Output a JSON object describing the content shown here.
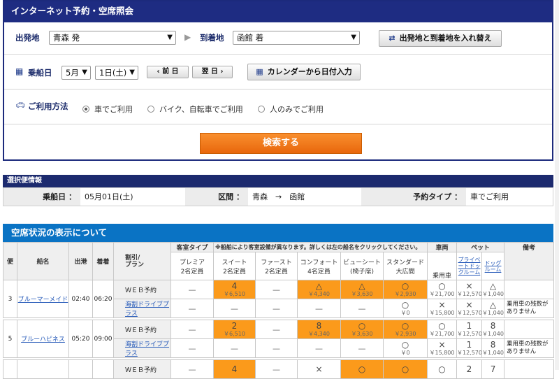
{
  "search": {
    "title": "インターネット予約・空席照会",
    "departure_label": "出発地",
    "departure_value": "青森 発",
    "arrival_label": "到着地",
    "arrival_value": "函館 着",
    "swap_label": "出発地と到着地を入れ替え",
    "date_label": "乗船日",
    "month_value": "5月",
    "day_value": "1日(土)",
    "prev_label": "前 日",
    "next_label": "翌 日",
    "calendar_label": "カレンダーから日付入力",
    "method_label": "ご利用方法",
    "methods": [
      "車でご利用",
      "バイク、自転車でご利用",
      "人のみでご利用"
    ],
    "selected_method": 0,
    "search_button": "検索する"
  },
  "selected_info": {
    "title": "選択便情報",
    "date_key": "乗船日 ：",
    "date_value": "05月01日(土)",
    "section_key": "区間 ：",
    "section_value": "青森　→　函館",
    "type_key": "予約タイプ ：",
    "type_value": "車でご利用"
  },
  "seat_status": {
    "title": "空席状況の表示について",
    "headers": {
      "bin": "便",
      "ship": "船名",
      "dep": "出港",
      "arr": "着着",
      "plan": "割引/\nプラン",
      "cabin_type": "客室タイプ",
      "note_text": "※船舶により客室設備が異なります。詳しくは左の船名をクリックしてください。",
      "vehicle": "車両",
      "pet": "ペット",
      "remarks": "備考"
    },
    "cabins": [
      {
        "name": "プレミア",
        "cap": "2名定員"
      },
      {
        "name": "スイート",
        "cap": "2名定員"
      },
      {
        "name": "ファースト",
        "cap": "2名定員"
      },
      {
        "name": "コンフォート",
        "cap": "4名定員"
      },
      {
        "name": "ビューシート",
        "cap": "(椅子席)"
      },
      {
        "name": "スタンダード",
        "cap": "大広間"
      }
    ],
    "vehicle_sub": "乗用車",
    "pet_room": "プライベートドックルーム",
    "dog_room": "ドッグルーム",
    "rows": [
      {
        "bin": "3",
        "ship": "ブルーマーメイド",
        "dep": "02:40",
        "arr": "06:20",
        "plan1": "ＷＥＢ予約",
        "r1": [
          [
            "—",
            ""
          ],
          [
            "4",
            "￥6,510"
          ],
          [
            "—",
            ""
          ],
          [
            "△",
            "￥4,340"
          ],
          [
            "△",
            "￥3,630"
          ],
          [
            "○",
            "￥2,930"
          ]
        ],
        "r1v": [
          "○",
          "￥21,700"
        ],
        "r1p": [
          "×",
          "￥12,570"
        ],
        "r1d": [
          "△",
          "￥1,040"
        ],
        "plan2": "海割ドライブプラス",
        "r2v": [
          "×",
          "￥15,800"
        ],
        "r2p": [
          "×",
          "￥12,570"
        ],
        "r2d": [
          "△",
          "￥1,040"
        ],
        "r2s": [
          "○",
          "￥0"
        ],
        "note": "乗用車の残数がありません"
      },
      {
        "bin": "5",
        "ship": "ブルーハピネス",
        "dep": "05:20",
        "arr": "09:00",
        "plan1": "ＷＥＢ予約",
        "r1": [
          [
            "—",
            ""
          ],
          [
            "2",
            "￥6,510"
          ],
          [
            "—",
            ""
          ],
          [
            "8",
            "￥4,340"
          ],
          [
            "○",
            "￥3,630"
          ],
          [
            "○",
            "￥2,930"
          ]
        ],
        "r1v": [
          "○",
          "￥21,700"
        ],
        "r1p": [
          "1",
          "￥12,570"
        ],
        "r1d": [
          "8",
          "￥1,040"
        ],
        "plan2": "海割ドライブプラス",
        "r2v": [
          "×",
          "￥15,800"
        ],
        "r2p": [
          "1",
          "￥12,570"
        ],
        "r2d": [
          "8",
          "￥1,040"
        ],
        "r2s": [
          "○",
          "￥0"
        ],
        "note": "乗用車の残数がありません"
      },
      {
        "plan1": "ＷＥＢ予約",
        "r1": [
          [
            "—",
            ""
          ],
          [
            "4",
            ""
          ],
          [
            "—",
            ""
          ],
          [
            "×",
            ""
          ],
          [
            "○",
            ""
          ],
          [
            "○",
            ""
          ]
        ],
        "r1v": [
          "○",
          ""
        ],
        "r1p": [
          "2",
          ""
        ],
        "r1d": [
          "7",
          ""
        ]
      }
    ]
  }
}
